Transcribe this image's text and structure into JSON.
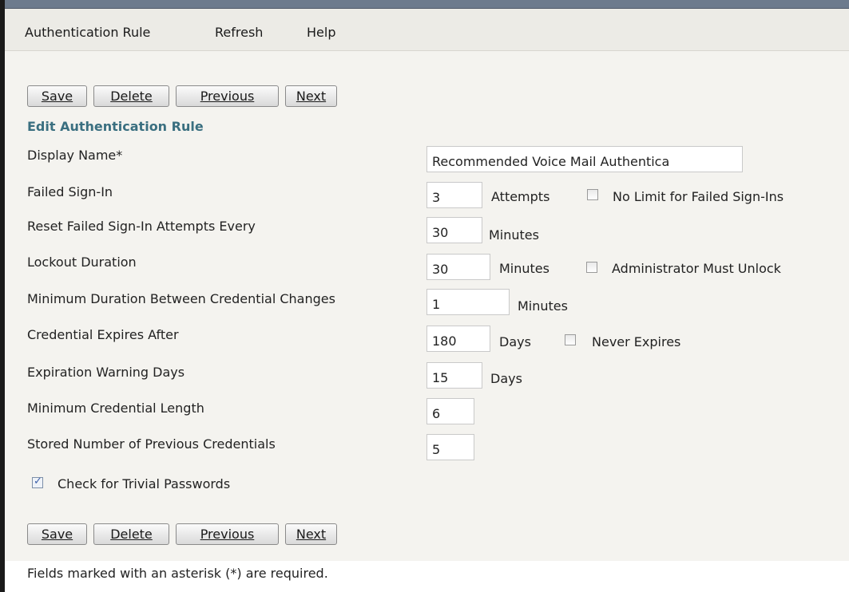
{
  "menu": {
    "items": [
      "Authentication Rule",
      "Refresh",
      "Help"
    ]
  },
  "buttons": {
    "save": "Save",
    "delete": "Delete",
    "previous": "Previous",
    "next": "Next"
  },
  "section_title": "Edit Authentication Rule",
  "fields": {
    "display_name": {
      "label": "Display Name*",
      "value": "Recommended Voice Mail Authentica"
    },
    "failed_sign_in": {
      "label": "Failed Sign-In",
      "value": "3",
      "unit": "Attempts",
      "checkbox_label": "No Limit for Failed Sign-Ins",
      "checkbox_checked": false
    },
    "reset_failed": {
      "label": "Reset Failed Sign-In Attempts Every",
      "value": "30",
      "unit": "Minutes"
    },
    "lockout_duration": {
      "label": "Lockout Duration",
      "value": "30",
      "unit": "Minutes",
      "checkbox_label": "Administrator Must Unlock",
      "checkbox_checked": false
    },
    "min_duration": {
      "label": "Minimum Duration Between Credential Changes",
      "value": "1",
      "unit": "Minutes"
    },
    "credential_expires": {
      "label": "Credential Expires After",
      "value": "180",
      "unit": "Days",
      "checkbox_label": "Never Expires",
      "checkbox_checked": false
    },
    "expiration_warning": {
      "label": "Expiration Warning Days",
      "value": "15",
      "unit": "Days"
    },
    "min_length": {
      "label": "Minimum Credential Length",
      "value": "6"
    },
    "stored_previous": {
      "label": "Stored Number of Previous Credentials",
      "value": "5"
    }
  },
  "trivial_passwords": {
    "label": "Check for Trivial Passwords",
    "checked": true
  },
  "footer": "Fields marked with an asterisk (*) are required."
}
